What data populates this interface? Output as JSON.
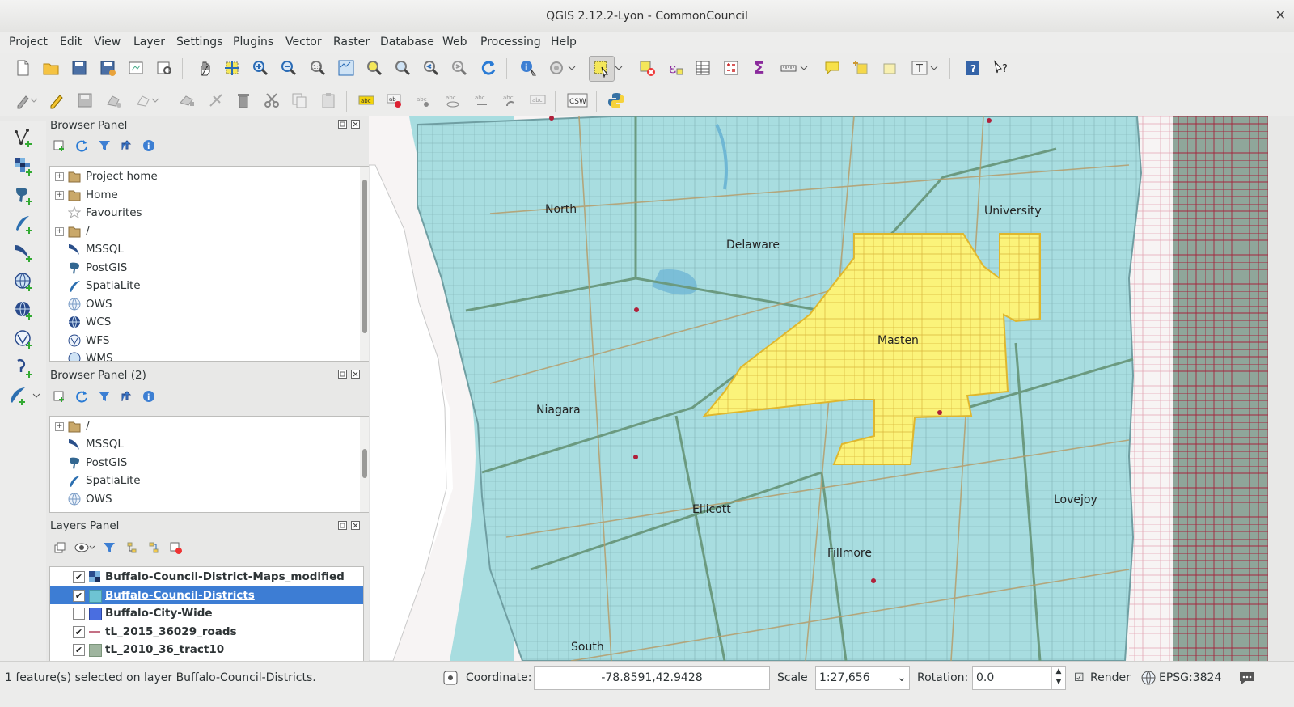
{
  "window": {
    "title": "QGIS 2.12.2-Lyon - CommonCouncil",
    "close_glyph": "✕"
  },
  "menu": [
    "Project",
    "Edit",
    "View",
    "Layer",
    "Settings",
    "Plugins",
    "Vector",
    "Raster",
    "Database",
    "Web",
    "Processing",
    "Help"
  ],
  "toolbar2": {
    "csw_label": "CSW"
  },
  "browser_panel": {
    "title": "Browser Panel",
    "items": [
      "Project home",
      "Home",
      "Favourites",
      "/",
      "MSSQL",
      "PostGIS",
      "SpatiaLite",
      "OWS",
      "WCS",
      "WFS",
      "WMS"
    ]
  },
  "browser_panel_2": {
    "title": "Browser Panel (2)",
    "items": [
      "/",
      "MSSQL",
      "PostGIS",
      "SpatiaLite",
      "OWS"
    ]
  },
  "layers_panel": {
    "title": "Layers Panel",
    "layers": [
      {
        "name": "Buffalo-Council-District-Maps_modified",
        "checked": true,
        "swatch": "raster"
      },
      {
        "name": "Buffalo-Council-Districts",
        "checked": true,
        "swatch": "#6ec3d3",
        "selected": true
      },
      {
        "name": "Buffalo-City-Wide",
        "checked": false,
        "swatch": "#4a6ee0"
      },
      {
        "name": "tL_2015_36029_roads",
        "checked": true,
        "swatch": "line"
      },
      {
        "name": "tL_2010_36_tract10",
        "checked": true,
        "swatch": "#9fb59f"
      }
    ]
  },
  "map": {
    "labels": [
      "North",
      "Delaware",
      "University",
      "Masten",
      "Niagara",
      "Ellicott",
      "Lovejoy",
      "Fillmore",
      "South"
    ],
    "colors": {
      "district_fill": "#a8dde0",
      "selected_fill": "#fbf37a",
      "roads": "#a4263d",
      "water": "#6fb7d4"
    }
  },
  "status": {
    "message": "1 feature(s) selected on layer Buffalo-Council-Districts.",
    "coordinate_label": "Coordinate:",
    "coordinate_value": "-78.8591,42.9428",
    "scale_label": "Scale",
    "scale_value": "1:27,656",
    "rotation_label": "Rotation:",
    "rotation_value": "0.0",
    "render_label": "Render",
    "crs": "EPSG:3824"
  }
}
